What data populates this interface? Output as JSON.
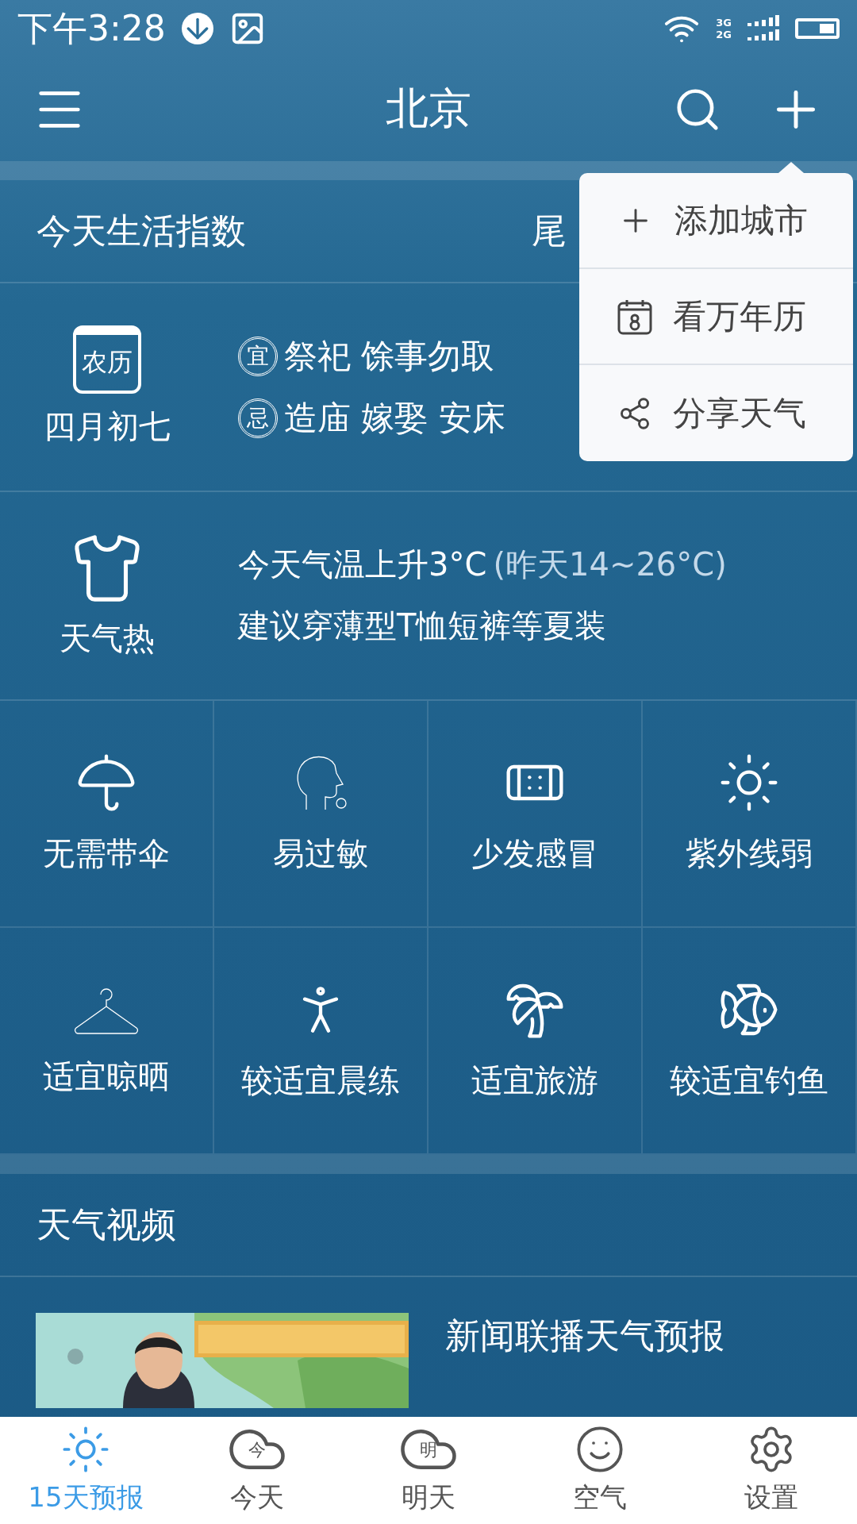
{
  "status_bar": {
    "time": "下午3:28",
    "network": [
      "3G",
      "2G"
    ]
  },
  "header": {
    "title": "北京"
  },
  "life_index": {
    "title": "今天生活指数",
    "right_text": "尾"
  },
  "almanac": {
    "icon_text": "农历",
    "date": "四月初七",
    "lines": [
      {
        "badge": "宜",
        "text": "祭祀 馀事勿取"
      },
      {
        "badge": "忌",
        "text": "造庙 嫁娶 安床"
      }
    ]
  },
  "clothing": {
    "label": "天气热",
    "line_1": "今天气温上升3°C",
    "line_1_note": "(昨天14~26°C)",
    "line_2": "建议穿薄型T恤短裤等夏装"
  },
  "indices": [
    {
      "label": "无需带伞"
    },
    {
      "label": "易过敏"
    },
    {
      "label": "少发感冒"
    },
    {
      "label": "紫外线弱"
    },
    {
      "label": "适宜晾晒"
    },
    {
      "label": "较适宜晨练"
    },
    {
      "label": "适宜旅游"
    },
    {
      "label": "较适宜钓鱼"
    }
  ],
  "video": {
    "title": "天气视频",
    "items": [
      {
        "kind": "picture",
        "title": "新闻联播天气预报"
      }
    ]
  },
  "popup_menu": [
    {
      "label": "添加城市"
    },
    {
      "label": "看万年历"
    },
    {
      "label": "分享天气"
    }
  ],
  "bottom_nav": [
    {
      "label": "15天预报",
      "selected": true
    },
    {
      "label": "今天",
      "icon_text": "今",
      "selected": false
    },
    {
      "label": "明天",
      "icon_text": "明",
      "selected": false
    },
    {
      "label": "空气",
      "selected": false
    },
    {
      "label": "设置",
      "selected": false
    }
  ]
}
